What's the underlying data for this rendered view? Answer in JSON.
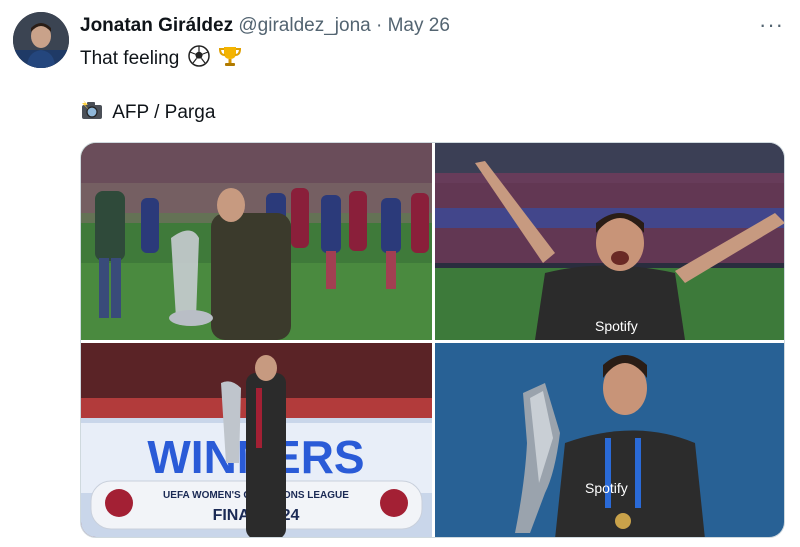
{
  "tweet": {
    "author_name": "Jonatan Giráldez",
    "handle": "@giraldez_jona",
    "separator": "·",
    "date": "May 26",
    "more_label": "···",
    "line1": "That feeling",
    "line2": "AFP / Parga"
  },
  "icons": {
    "avatar": "profile-photo",
    "line1_emojis": [
      "soccer-ball-icon",
      "trophy-icon"
    ],
    "line2_emoji": "camera-with-flash-icon",
    "more": "more-options-icon"
  },
  "media": {
    "count": 4,
    "photo3_banner": {
      "big": "WINNERS",
      "small": "UEFA WOMEN'S CHAMPIONS LEAGUE",
      "final": "FINAL 2024"
    },
    "photo4_shirt_text": "Spotify",
    "photo2_shirt_text": "Spotify"
  },
  "colors": {
    "text": "#0f1419",
    "secondary": "#536471",
    "border": "#cfd9de"
  }
}
